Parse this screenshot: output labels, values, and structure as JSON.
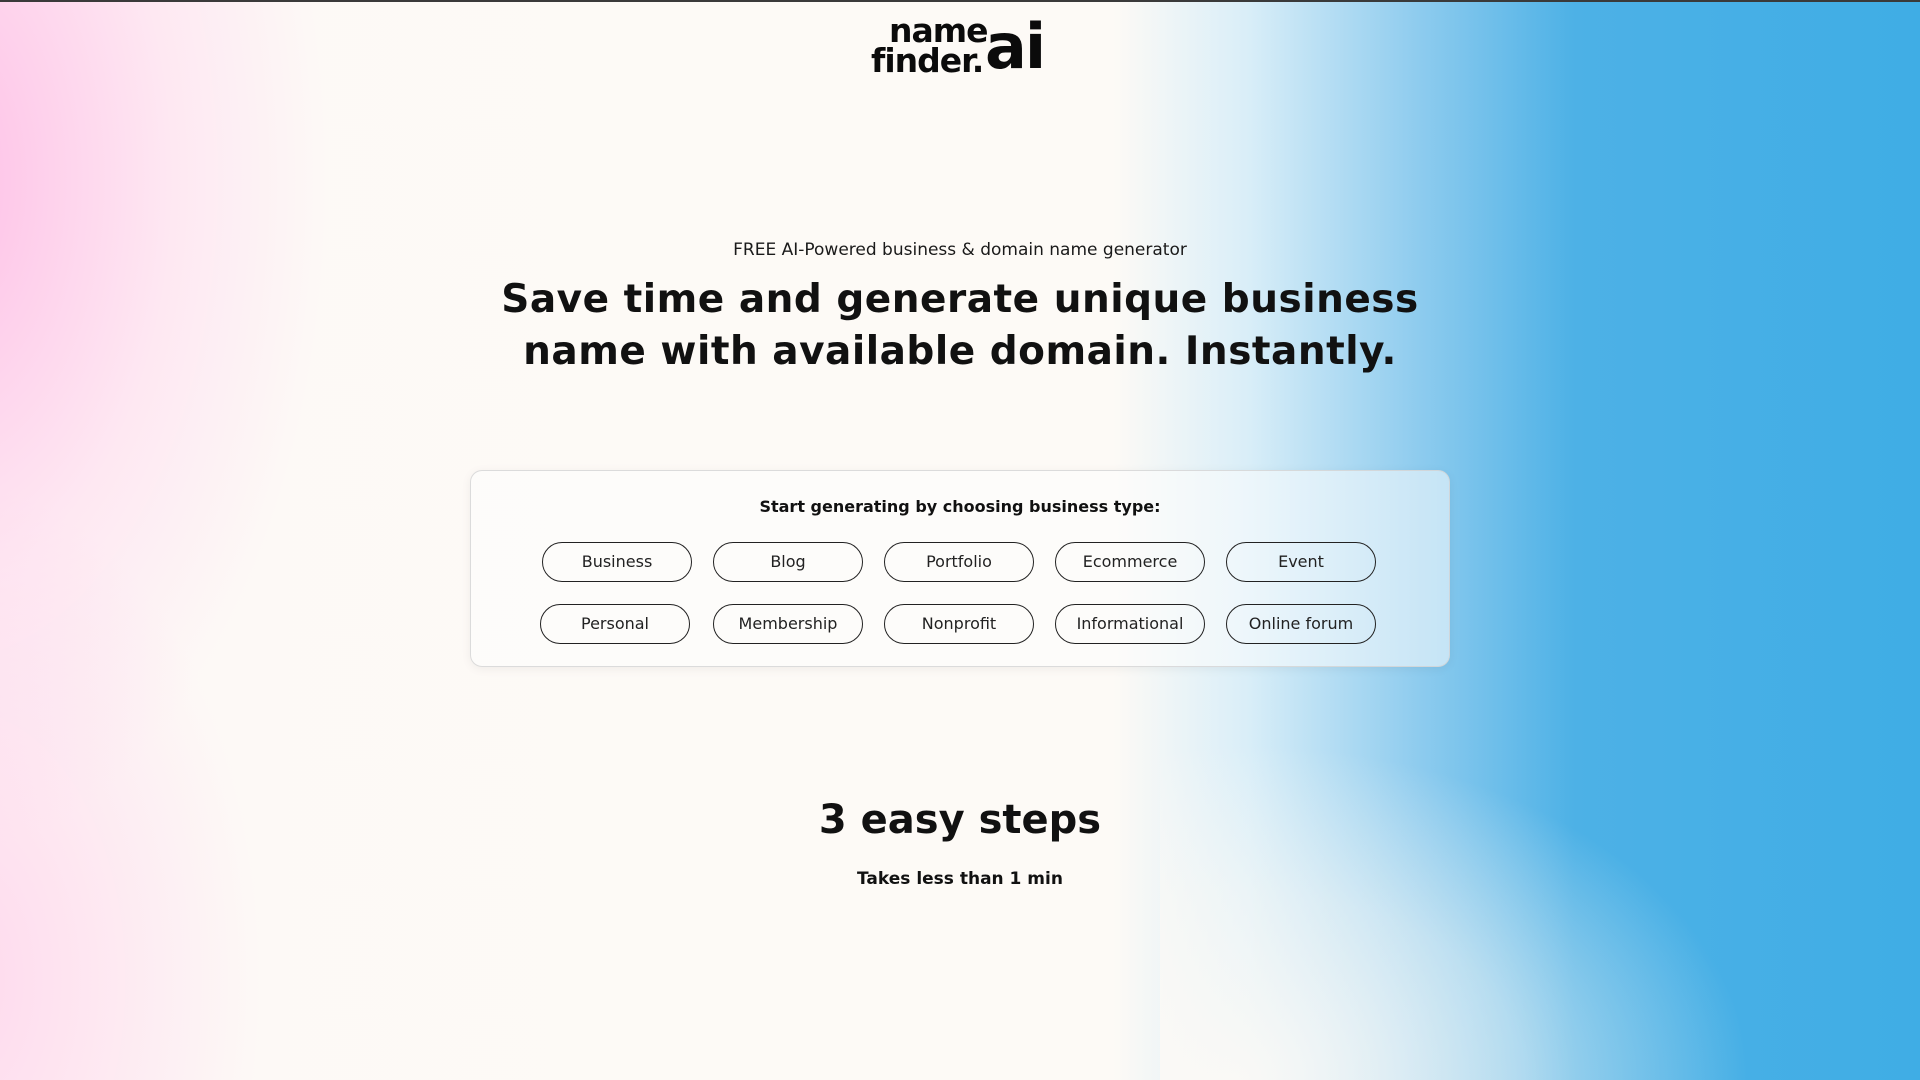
{
  "logo": {
    "line1": "name",
    "line2": "finder.",
    "accent": "ai"
  },
  "hero": {
    "tagline": "FREE AI-Powered business & domain name generator",
    "headline": "Save time and generate unique business name with available domain. Instantly."
  },
  "generator": {
    "prompt": "Start generating by choosing business type:",
    "row1": [
      "Business",
      "Blog",
      "Portfolio",
      "Ecommerce",
      "Event"
    ],
    "row2": [
      "Personal",
      "Membership",
      "Nonprofit",
      "Informational",
      "Online forum"
    ]
  },
  "steps": {
    "title": "3 easy steps",
    "subtitle": "Takes less than 1 min"
  },
  "colors": {
    "pink": "#ffb3e3",
    "blue": "#3fade5",
    "cream": "#fdfaf6",
    "text": "#111111"
  }
}
